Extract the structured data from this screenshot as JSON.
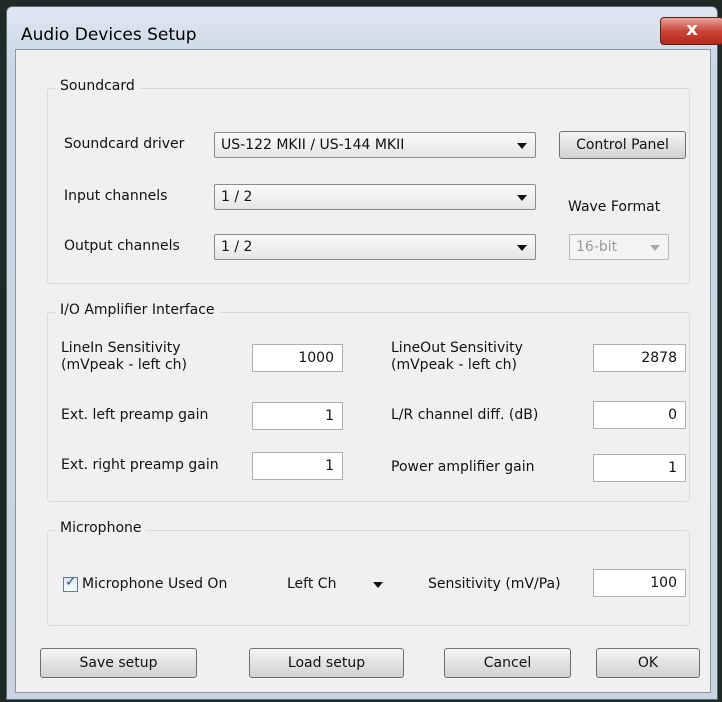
{
  "window": {
    "title": "Audio Devices Setup",
    "close_glyph": "x"
  },
  "soundcard": {
    "group_title": "Soundcard",
    "driver_label": "Soundcard driver",
    "driver_value": "US-122 MKII / US-144 MKII",
    "control_panel_label": "Control Panel",
    "input_label": "Input channels",
    "input_value": "1 / 2",
    "output_label": "Output channels",
    "output_value": "1 / 2",
    "wave_format_label": "Wave Format",
    "wave_format_value": "16-bit"
  },
  "io": {
    "group_title": "I/O Amplifier Interface",
    "linein_label_1": "LineIn Sensitivity",
    "linein_label_2": "(mVpeak - left ch)",
    "linein_value": "1000",
    "lineout_label_1": "LineOut Sensitivity",
    "lineout_label_2": "(mVpeak - left ch)",
    "lineout_value": "2878",
    "ext_left_label": "Ext. left preamp gain",
    "ext_left_value": "1",
    "lr_diff_label": "L/R channel diff. (dB)",
    "lr_diff_value": "0",
    "ext_right_label": "Ext. right preamp gain",
    "ext_right_value": "1",
    "power_amp_label": "Power amplifier gain",
    "power_amp_value": "1"
  },
  "microphone": {
    "group_title": "Microphone",
    "used_on_label": "Microphone Used On",
    "used_on_checked": true,
    "channel_value": "Left Ch",
    "sensitivity_label": "Sensitivity (mV/Pa)",
    "sensitivity_value": "100"
  },
  "buttons": {
    "save": "Save setup",
    "load": "Load setup",
    "cancel": "Cancel",
    "ok": "OK"
  }
}
